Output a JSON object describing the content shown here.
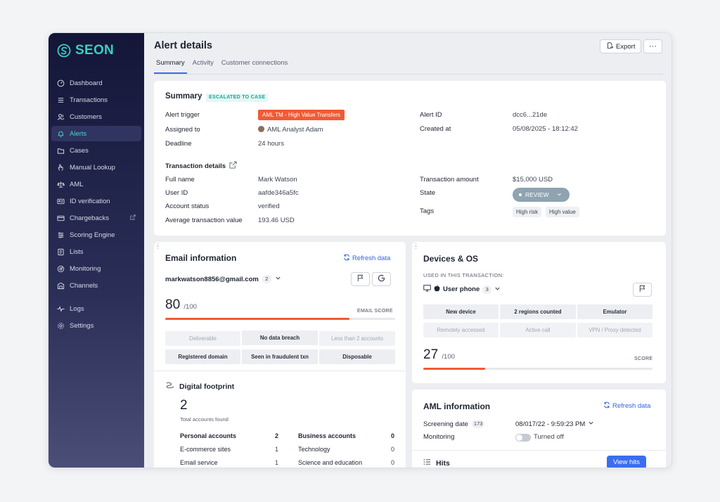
{
  "brand": {
    "name": "SEON",
    "accent": "#3ad0bd"
  },
  "sidebar": {
    "items": [
      {
        "label": "Dashboard",
        "icon": "dashboard-icon"
      },
      {
        "label": "Transactions",
        "icon": "list-icon"
      },
      {
        "label": "Customers",
        "icon": "users-icon"
      },
      {
        "label": "Alerts",
        "icon": "bell-icon",
        "active": true
      },
      {
        "label": "Cases",
        "icon": "folder-icon"
      },
      {
        "label": "Manual Lookup",
        "icon": "hand-icon"
      },
      {
        "label": "AML",
        "icon": "scale-icon"
      },
      {
        "label": "ID verification",
        "icon": "id-card-icon"
      },
      {
        "label": "Chargebacks",
        "icon": "card-icon"
      },
      {
        "label": "Scoring Engine",
        "icon": "engine-icon"
      },
      {
        "label": "Lists",
        "icon": "lists-icon"
      },
      {
        "label": "Monitoring",
        "icon": "monitoring-icon"
      },
      {
        "label": "Channels",
        "icon": "channels-icon"
      },
      {
        "label": "Logs",
        "icon": "pulse-icon"
      },
      {
        "label": "Settings",
        "icon": "gear-icon"
      }
    ]
  },
  "header": {
    "title": "Alert details",
    "export_label": "Export",
    "more_label": "···",
    "tabs": [
      {
        "label": "Summary"
      },
      {
        "label": "Activity"
      },
      {
        "label": "Customer connections"
      }
    ]
  },
  "summary": {
    "title": "Summary",
    "status_badge": "ESCALATED TO CASE",
    "alert_trigger_label": "Alert trigger",
    "alert_trigger_value": "AML TM - High Value Transfers",
    "assigned_to_label": "Assigned to",
    "assigned_to_value": "AML Analyst Adam",
    "deadline_label": "Deadline",
    "deadline_value": "24 hours",
    "alert_id_label": "Alert ID",
    "alert_id_value": "dcc6...21de",
    "created_at_label": "Created at",
    "created_at_value": "05/08/2025 - 18:12:42",
    "transaction_details_title": "Transaction details",
    "full_name_label": "Full name",
    "full_name_value": "Mark Watson",
    "user_id_label": "User ID",
    "user_id_value": "aafde346a5fc",
    "account_status_label": "Account status",
    "account_status_value": "verified",
    "avg_tx_label": "Average transaction value",
    "avg_tx_value": "193.46 USD",
    "tx_amount_label": "Transaction amount",
    "tx_amount_value": "$15,000 USD",
    "state_label": "State",
    "state_value": "REVIEW",
    "tags_label": "Tags",
    "tags": [
      "High risk",
      "High value"
    ]
  },
  "email": {
    "title": "Email information",
    "refresh_label": "Refresh data",
    "address": "markwatson8856@gmail.com",
    "address_count": "2",
    "score": "80",
    "score_max": "/100",
    "score_fraction": 0.8,
    "score_label": "EMAIL SCORE",
    "chips": [
      {
        "label": "Deliverable",
        "on": false
      },
      {
        "label": "No data breach",
        "on": true
      },
      {
        "label": "Less than 2 accounts",
        "on": false
      },
      {
        "label": "Registered domain",
        "on": true
      },
      {
        "label": "Seen in fraudulent txn",
        "on": true
      },
      {
        "label": "Disposable",
        "on": true
      }
    ],
    "footprint_title": "Digital footprint",
    "total_accounts": "2",
    "total_accounts_label": "Total accounts found",
    "rows_left": [
      {
        "label": "Personal accounts",
        "value": "2",
        "bold": true
      },
      {
        "label": "E-commerce sites",
        "value": "1"
      },
      {
        "label": "Email service",
        "value": "1"
      }
    ],
    "rows_right": [
      {
        "label": "Business accounts",
        "value": "0",
        "bold": true
      },
      {
        "label": "Technology",
        "value": "0"
      },
      {
        "label": "Science and education",
        "value": "0"
      }
    ]
  },
  "devices": {
    "title": "Devices & OS",
    "used_label": "USED IN THIS TRANSACTION:",
    "device_name": "User phone",
    "device_count": "3",
    "chips": [
      {
        "label": "New device",
        "on": true
      },
      {
        "label": "2 regions counted",
        "on": true
      },
      {
        "label": "Emulator",
        "on": true
      },
      {
        "label": "Remotely accessed",
        "on": false
      },
      {
        "label": "Active call",
        "on": false
      },
      {
        "label": "VPN / Proxy detected",
        "on": false
      }
    ],
    "score": "27",
    "score_max": "/100",
    "score_fraction": 0.27,
    "score_label": "SCORE"
  },
  "aml": {
    "title": "AML information",
    "refresh_label": "Refresh data",
    "screening_label": "Screening date",
    "screening_count": "173",
    "screening_value": "08/017/22 - 9:59:23 PM",
    "monitoring_label": "Monitoring",
    "monitoring_value": "Turned off",
    "hits_label": "Hits",
    "view_hits_label": "View hits"
  }
}
